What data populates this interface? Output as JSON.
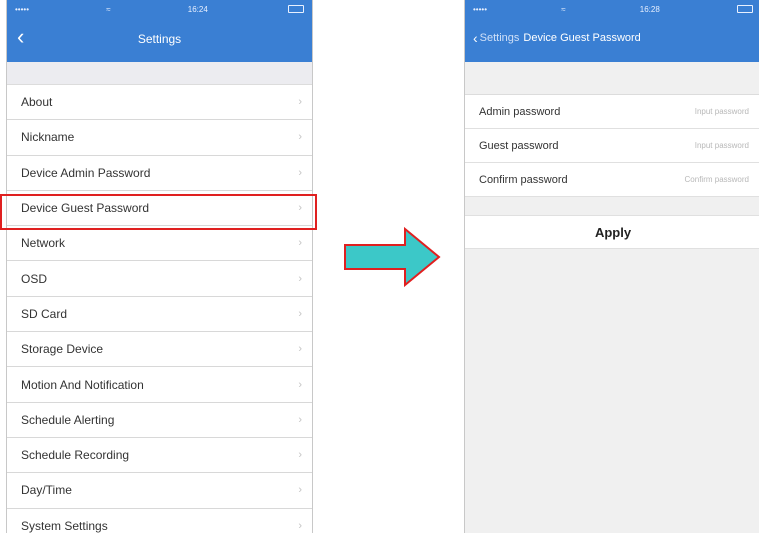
{
  "left_screen": {
    "status": {
      "carrier": "•••••",
      "wifi": "≈",
      "time": "16:24",
      "battery_label": ""
    },
    "nav": {
      "title": "Settings",
      "back_icon": "chevron-left-icon"
    },
    "items": [
      {
        "label": "About"
      },
      {
        "label": "Nickname"
      },
      {
        "label": "Device Admin Password"
      },
      {
        "label": "Device Guest Password"
      },
      {
        "label": "Network"
      },
      {
        "label": "OSD"
      },
      {
        "label": "SD Card"
      },
      {
        "label": "Storage Device"
      },
      {
        "label": "Motion And Notification"
      },
      {
        "label": "Schedule Alerting"
      },
      {
        "label": "Schedule Recording"
      },
      {
        "label": "Day/Time"
      },
      {
        "label": "System Settings"
      }
    ],
    "highlighted_item": "Device Guest Password",
    "highlight_color": "#e02020"
  },
  "arrow": {
    "fill": "#3cc8c8",
    "stroke": "#e02020"
  },
  "right_screen": {
    "status": {
      "carrier": "•••••",
      "wifi": "≈",
      "time": "16:28",
      "battery_label": ""
    },
    "nav": {
      "back_label": "Settings",
      "title": "Device Guest Password"
    },
    "fields": [
      {
        "label": "Admin password",
        "placeholder": "Input password"
      },
      {
        "label": "Guest password",
        "placeholder": "Input password"
      },
      {
        "label": "Confirm password",
        "placeholder": "Confirm password"
      }
    ],
    "apply_label": "Apply"
  },
  "colors": {
    "nav_blue": "#3a7fd3"
  }
}
